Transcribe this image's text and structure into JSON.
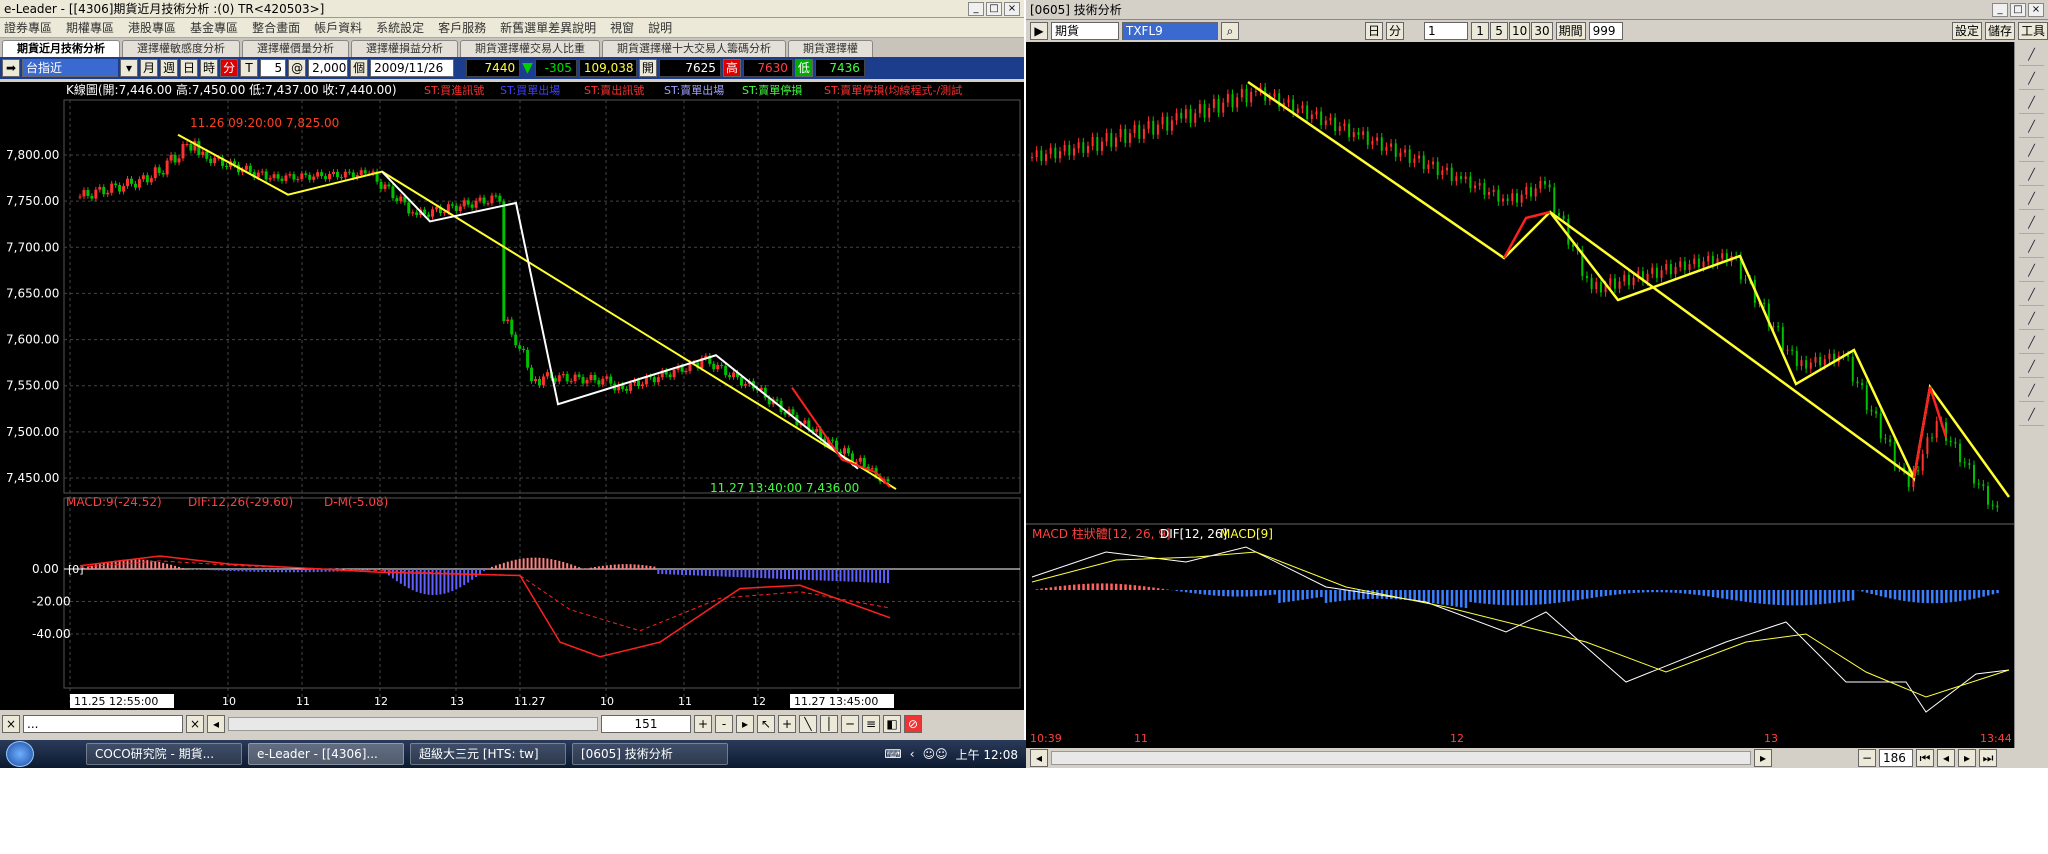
{
  "left": {
    "title": "e-Leader - [[4306]期貨近月技術分析 :(0) TR<420503>]",
    "menu": [
      "證券專區",
      "期權專區",
      "港股專區",
      "基金專區",
      "整合畫面",
      "帳戶資料",
      "系統設定",
      "客戶服務",
      "新舊選單差異說明",
      "視窗",
      "說明"
    ],
    "tabs": [
      "期貨近月技術分析",
      "選擇權敏感度分析",
      "選擇權價量分析",
      "選擇權損益分析",
      "期貨選擇權交易人比重",
      "期貨選擇權十大交易人籌碼分析",
      "期貨選擇權"
    ],
    "toolbar": {
      "symbol": "台指近",
      "periods": [
        "月",
        "週",
        "日",
        "時",
        "分",
        "T"
      ],
      "interval": "5",
      "count": "2,000",
      "count_unit": "個",
      "date": "2009/11/26",
      "last": "7440",
      "change": "-305",
      "volume": "109,038",
      "open_label": "開",
      "open": "7625",
      "high_label": "高",
      "high": "7630",
      "low_label": "低",
      "low": "7436"
    },
    "kline_header": "K線圖(開:7,446.00 高:7,450.00 低:7,437.00 收:7,440.00)",
    "signals": [
      "ST:買進訊號",
      "ST:買單出場",
      "ST:賣出訊號",
      "ST:賣單出場",
      "ST:賣單停損",
      "ST:賣單停損(均線程式-/測試"
    ],
    "annotation_high": "11.26 09:20:00  7,825.00",
    "annotation_low": "11.27 13:40:00  7,436.00",
    "price_ticks": [
      "7,800.00",
      "7,750.00",
      "7,700.00",
      "7,650.00",
      "7,600.00",
      "7,550.00",
      "7,500.00",
      "7,450.00"
    ],
    "macd_header": {
      "macd": "MACD:9(-24.52)",
      "dif": "DIF:12,26(-29.60)",
      "dm": "D-M(-5.08)"
    },
    "macd_ticks": [
      "0.00",
      "-20.00",
      "-40.00"
    ],
    "macd_zero_marker": "[0]",
    "time_start": "11.25 12:55:00",
    "time_ticks": [
      "10",
      "11",
      "12",
      "13",
      "11.27",
      "10",
      "11",
      "12"
    ],
    "time_end": "11.27 13:45:00",
    "bottom": {
      "ellipsis": "...",
      "count": "151"
    },
    "taskbar": [
      "COCO研究院 - 期貨...",
      "e-Leader - [[4306]...",
      "超級大三元  [HTS: tw]",
      "[0605] 技術分析"
    ],
    "clock": "上午 12:08"
  },
  "right": {
    "title": "[0605] 技術分析",
    "product_type": "期貨",
    "symbol": "TXFL9",
    "period": "日",
    "period2": "分",
    "interval": "1",
    "presets": [
      "1",
      "5",
      "10",
      "30"
    ],
    "count_label": "期間",
    "count": "999",
    "buttons": [
      "設定",
      "儲存",
      "工具"
    ],
    "macd_label": {
      "hist": "MACD 柱狀體[12, 26, 9]",
      "dif": "DIF[12, 26]",
      "macd": "MACD[9]"
    },
    "time_ticks": [
      "10:39",
      "11",
      "12",
      "13",
      "13:44"
    ],
    "bottom_count": "186"
  },
  "colors": {
    "up": "#ff3030",
    "down": "#00c000",
    "trend_yellow": "#ffff30",
    "trend_white": "#ffffff",
    "hist_pos": "#ff8080",
    "hist_neg": "#6060ff",
    "right_hist_neg": "#3a7fff",
    "right_hist_pos": "#ff6060"
  }
}
